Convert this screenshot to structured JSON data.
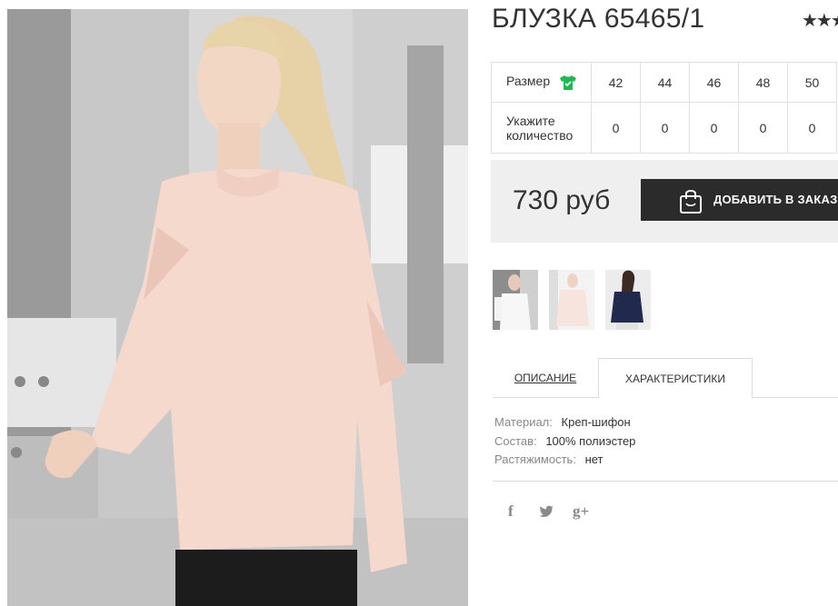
{
  "product": {
    "title": "БЛУЗКА 65465/1",
    "rating_stars": "★★★"
  },
  "sizes": {
    "size_label": "Размер",
    "qty_label_line1": "Укажите",
    "qty_label_line2": "количество",
    "values": [
      "42",
      "44",
      "46",
      "48",
      "50"
    ],
    "quantities": [
      "0",
      "0",
      "0",
      "0",
      "0"
    ]
  },
  "price": {
    "amount": "730 руб",
    "order_button": "ДОБАВИТЬ В ЗАКАЗ"
  },
  "tabs": {
    "description": "ОПИСАНИЕ",
    "characteristics": "ХАРАКТЕРИСТИКИ",
    "active": "characteristics"
  },
  "characteristics": [
    {
      "key": "Материал:",
      "value": "Креп-шифон"
    },
    {
      "key": "Состав:",
      "value": "100% полиэстер"
    },
    {
      "key": "Растяжимость:",
      "value": "нет"
    }
  ],
  "social": {
    "facebook": "f",
    "twitter": "🐦",
    "googleplus": "g+"
  },
  "colors": {
    "accent_green": "#1db954",
    "button_dark": "#2b2b2b",
    "price_bg": "#efefef",
    "blouse_pink": "#f5d9cd"
  },
  "icons": [
    "shirt-icon",
    "shopping-bag-icon",
    "facebook-icon",
    "twitter-icon",
    "google-plus-icon",
    "star-icon"
  ]
}
